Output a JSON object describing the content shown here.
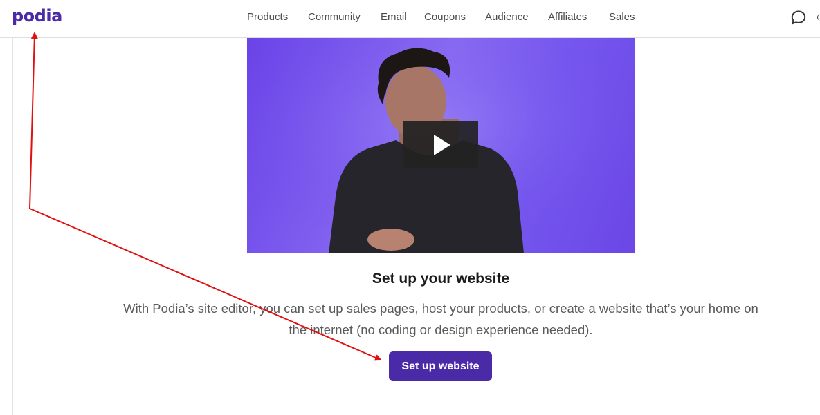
{
  "header": {
    "logo_text": "podia",
    "nav": [
      {
        "label": "Products"
      },
      {
        "label": "Community"
      },
      {
        "label": "Email"
      },
      {
        "label": "Coupons"
      },
      {
        "label": "Audience"
      },
      {
        "label": "Affiliates"
      },
      {
        "label": "Sales"
      }
    ],
    "chat_icon": "chat-bubble-icon"
  },
  "video": {
    "play_icon": "play-icon"
  },
  "section": {
    "title": "Set up your website",
    "description": "With Podia’s site editor, you can set up sales pages, host your products, or create a website that’s your home on the internet (no coding or design experience needed).",
    "cta_label": "Set up website"
  },
  "colors": {
    "brand": "#4b2aa8",
    "annotation_arrow": "#e01010",
    "video_background": "#7a5cf0"
  }
}
